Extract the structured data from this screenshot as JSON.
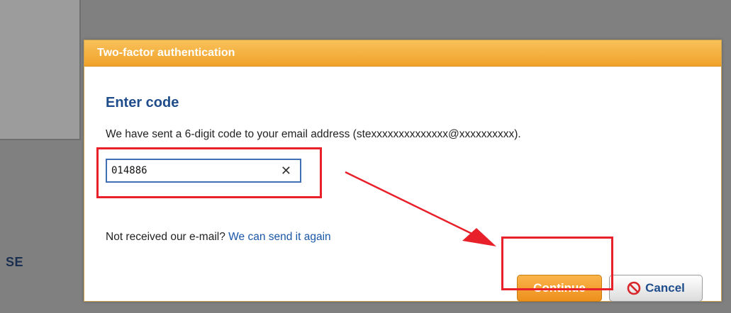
{
  "background": {
    "side_label": "SE"
  },
  "dialog": {
    "title": "Two-factor authentication",
    "heading": "Enter code",
    "message": "We have sent a 6-digit code to your email address (stexxxxxxxxxxxxxx@xxxxxxxxxx).",
    "code_input": {
      "value": "014886"
    },
    "clear_icon": "close-icon",
    "resend": {
      "prefix": "Not received our e-mail?",
      "link_text": "We can send it again"
    },
    "buttons": {
      "continue_label": "Continue",
      "cancel_label": "Cancel"
    }
  },
  "colors": {
    "header": "#f0a22a",
    "heading_text": "#1f4d8c",
    "link": "#1a56a8",
    "continue_button": "#ee8f1c",
    "annotation": "#e8202a"
  }
}
